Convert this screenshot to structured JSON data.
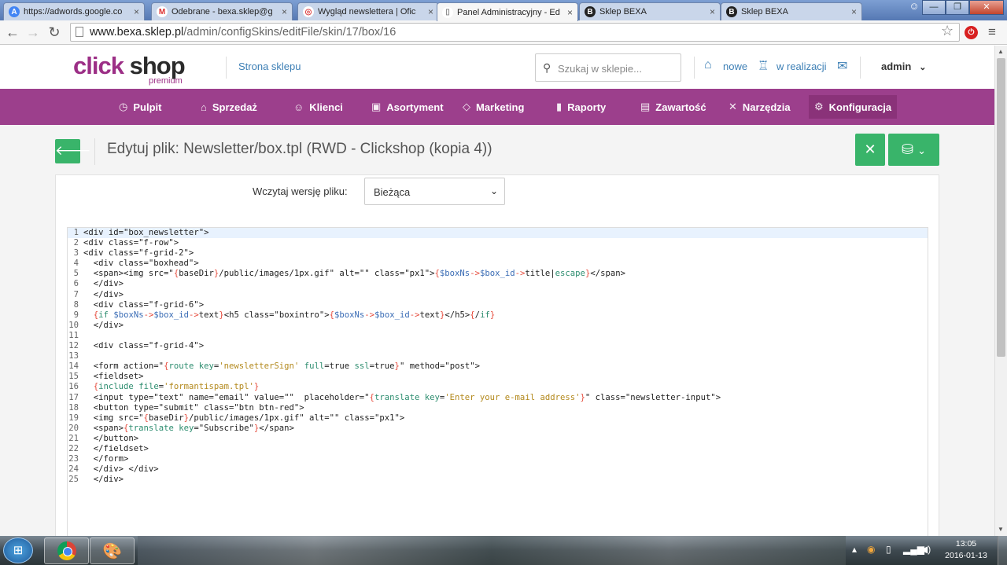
{
  "browser": {
    "tabs": [
      {
        "title": "https://adwords.google.co",
        "icon": "adwords-icon"
      },
      {
        "title": "Odebrane - bexa.sklep@g",
        "icon": "gmail-icon"
      },
      {
        "title": "Wygląd newslettera | Ofic",
        "icon": "lifebuoy-icon"
      },
      {
        "title": "Panel Administracyjny - Ed",
        "icon": "page-icon"
      },
      {
        "title": "Sklep BEXA",
        "icon": "bexa-icon"
      },
      {
        "title": "Sklep BEXA",
        "icon": "bexa-icon"
      }
    ],
    "url_host": "www.bexa.sklep.pl",
    "url_path": "/admin/configSkins/editFile/skin/17/box/16"
  },
  "header": {
    "logo_main": "click",
    "logo_shop": "shop",
    "logo_sub": "premium",
    "store_link": "Strona sklepu",
    "search_placeholder": "Szukaj w sklepie...",
    "new_label": "nowe",
    "inprogress_label": "w realizacji",
    "user": "admin"
  },
  "nav": [
    {
      "label": "Pulpit",
      "icon": "dashboard-icon",
      "glyph": "◷"
    },
    {
      "label": "Sprzedaż",
      "icon": "basket-icon",
      "glyph": "⌂"
    },
    {
      "label": "Klienci",
      "icon": "users-icon",
      "glyph": "☺"
    },
    {
      "label": "Asortyment",
      "icon": "box-icon",
      "glyph": "▣"
    },
    {
      "label": "Marketing",
      "icon": "tag-icon",
      "glyph": "◇"
    },
    {
      "label": "Raporty",
      "icon": "chart-icon",
      "glyph": "▮"
    },
    {
      "label": "Zawartość",
      "icon": "document-icon",
      "glyph": "▤"
    },
    {
      "label": "Narzędzia",
      "icon": "tools-icon",
      "glyph": "✕"
    },
    {
      "label": "Konfiguracja",
      "icon": "gear-icon",
      "glyph": "⚙"
    }
  ],
  "page": {
    "title": "Edytuj plik: Newsletter/box.tpl (RWD - Clickshop (kopia 4))",
    "version_label": "Wczytaj wersję pliku:",
    "version_value": "Bieżąca"
  },
  "code": [
    "<div id=\"box_newsletter\">",
    "<div class=\"f-row\">",
    "<div class=\"f-grid-2\">",
    "  <div class=\"boxhead\">",
    "  <span><img src=\"{baseDir}/public/images/1px.gif\" alt=\"\" class=\"px1\">{$boxNs->$box_id->title|escape}</span>",
    "  </div>",
    "  </div>",
    "  <div class=\"f-grid-6\">",
    "  {if $boxNs->$box_id->text}<h5 class=\"boxintro\">{$boxNs->$box_id->text}</h5>{/if}",
    "  </div>",
    "",
    "  <div class=\"f-grid-4\">",
    "",
    "  <form action=\"{route key='newsletterSign' full=true ssl=true}\" method=\"post\">",
    "  <fieldset>",
    "  {include file='formantispam.tpl'}",
    "  <input type=\"text\" name=\"email\" value=\"\"  placeholder=\"{translate key='Enter your e-mail address'}\" class=\"newsletter-input\">",
    "  <button type=\"submit\" class=\"btn btn-red\">",
    "  <img src=\"{baseDir}/public/images/1px.gif\" alt=\"\" class=\"px1\">",
    "  <span>{translate key=\"Subscribe\"}</span>",
    "  </button>",
    "  </fieldset>",
    "  </form>",
    "  </div> </div>",
    "  </div>"
  ],
  "taskbar": {
    "time": "13:05",
    "date": "2016-01-13"
  },
  "colors": {
    "nav_bg": "#9c3f8c",
    "accent_green": "#39b46a",
    "link_blue": "#3d7fb5"
  }
}
